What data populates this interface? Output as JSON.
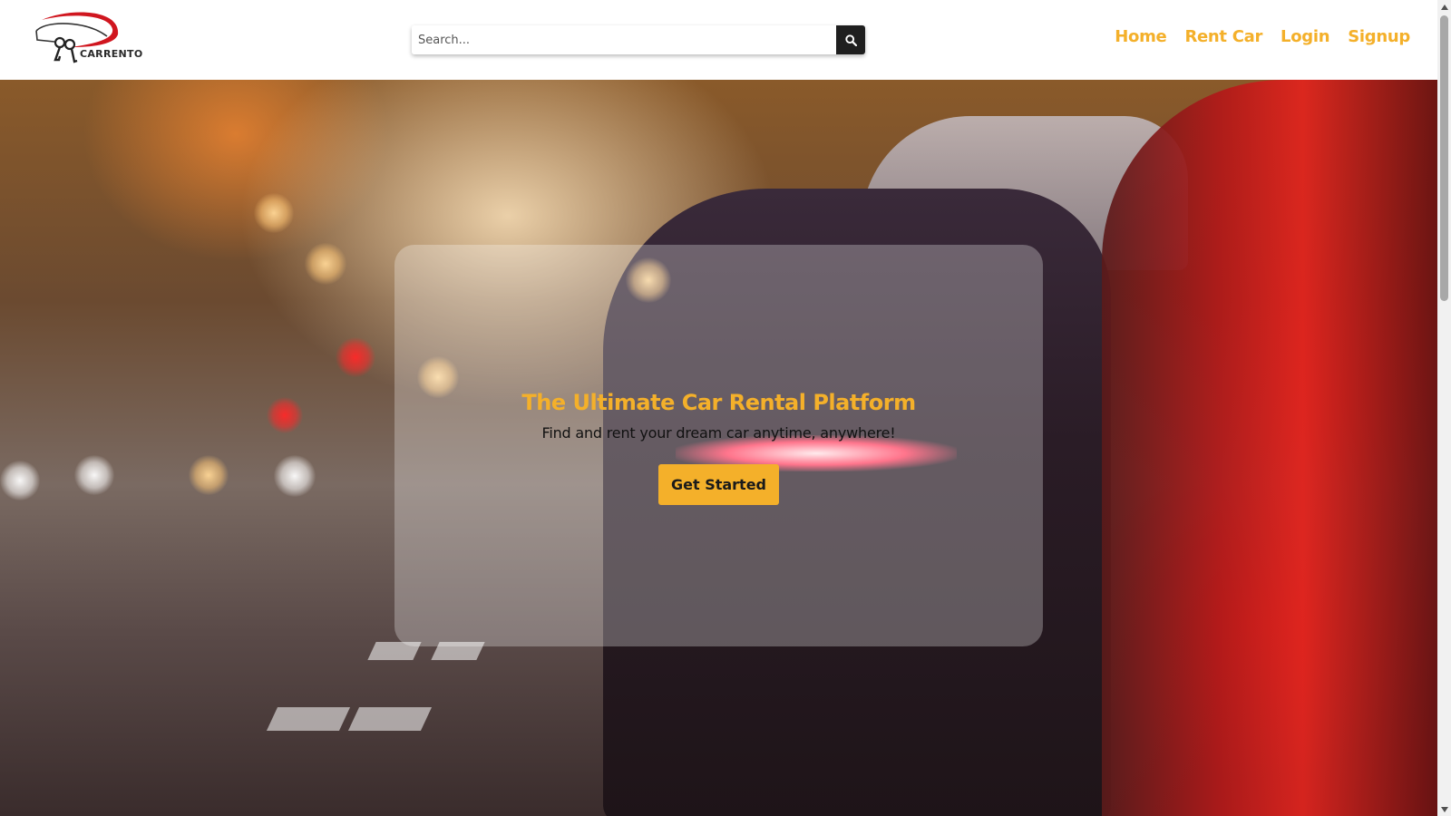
{
  "brand": {
    "name": "CARRENTO"
  },
  "search": {
    "placeholder": "Search...",
    "value": "",
    "button_icon": "search-icon"
  },
  "nav": {
    "items": [
      {
        "label": "Home"
      },
      {
        "label": "Rent Car"
      },
      {
        "label": "Login"
      },
      {
        "label": "Signup"
      }
    ]
  },
  "hero": {
    "title": "The Ultimate Car Rental Platform",
    "subtitle": "Find and rent your dream car anytime, anywhere!",
    "cta_label": "Get Started",
    "background_image": "blurred-city-street-red-sports-car"
  },
  "colors": {
    "accent": "#f4b02a",
    "search_button": "#1f1f1f",
    "logo_swoosh": "#d0161f",
    "header_bg": "#ffffff"
  }
}
